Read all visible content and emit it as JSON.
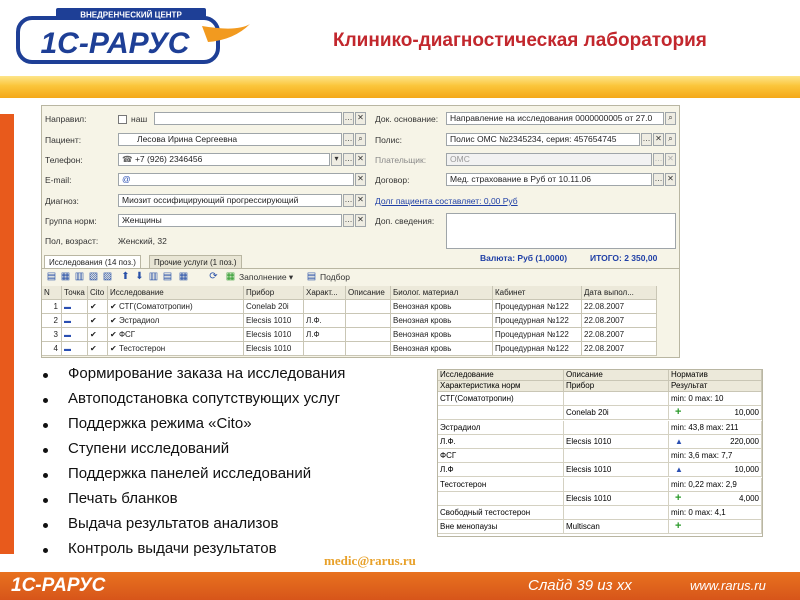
{
  "header": {
    "logo_top": "ВНЕДРЕНЧЕСКИЙ ЦЕНТР",
    "logo_main": "1С-РАРУС",
    "title": "Клинико-диагностическая лаборатория"
  },
  "form": {
    "labels": {
      "direction": "Направил:",
      "patient": "Пациент:",
      "phone": "Телефон:",
      "email": "E-mail:",
      "diagnosis": "Диагноз:",
      "norm_group": "Группа норм:",
      "sex_age": "Пол, возраст:",
      "doc_basis": "Док. основание:",
      "policy": "Полис:",
      "payer": "Плательщик:",
      "contract": "Договор:",
      "extra": "Доп. сведения:"
    },
    "direction_check_label": "наш",
    "patient_value": "Лесова Ирина Сергеевна",
    "phone_value": "+7 (926) 2346456",
    "email_value": "@",
    "diagnosis_value": "Миозит оссифицирующий прогрессирующий",
    "norm_group_value": "Женщины",
    "sex_age_value": "Женский, 32",
    "doc_basis_value": "Направление на исследования 0000000005 от 27.0",
    "policy_value": "Полис ОМС №2345234, серия: 457654745",
    "payer_value": "ОМС",
    "contract_value": "Мед. страхование в Руб от 10.11.06",
    "debt_link": "Долг пациента составляет: 0,00 Руб",
    "currency_text": "Валюта: Руб (1,0000)",
    "total_text": "ИТОГО: 2 350,00"
  },
  "tabs": [
    {
      "label": "Исследования (14 поз.)"
    },
    {
      "label": "Прочие услуги (1 поз.)"
    }
  ],
  "toolbar": {
    "fill_label": "Заполнение",
    "select_label": "Подбор"
  },
  "grid": {
    "headers": [
      "N",
      "Точка",
      "Cito",
      "Исследование",
      "Прибор",
      "Характ...",
      "Описание",
      "Биолог. материал",
      "Кабинет",
      "Дата выпол..."
    ],
    "rows": [
      {
        "n": "1",
        "study": "СТГ(Соматотропин)",
        "device": "Conelab 20i",
        "char": "",
        "material": "Венозная кровь",
        "room": "Процедурная №122",
        "date": "22.08.2007"
      },
      {
        "n": "2",
        "study": "Эстрадиол",
        "device": "Elecsis 1010",
        "char": "Л.Ф.",
        "material": "Венозная кровь",
        "room": "Процедурная №122",
        "date": "22.08.2007"
      },
      {
        "n": "3",
        "study": "ФСГ",
        "device": "Elecsis 1010",
        "char": "Л.Ф",
        "material": "Венозная кровь",
        "room": "Процедурная №122",
        "date": "22.08.2007"
      },
      {
        "n": "4",
        "study": "Тестостерон",
        "device": "Elecsis 1010",
        "char": "",
        "material": "Венозная кровь",
        "room": "Процедурная №122",
        "date": "22.08.2007"
      }
    ]
  },
  "bullets": [
    "Формирование заказа на исследования",
    "Автоподстановка сопутствующих услуг",
    "Поддержка режима «Cito»",
    "Ступени исследований",
    "Поддержка панелей исследований",
    "Печать бланков",
    "Выдача результатов анализов",
    "Контроль выдачи результатов"
  ],
  "results": {
    "headers_row1": [
      "Исследование",
      "Описание",
      "Норматив"
    ],
    "headers_row2": [
      "Характеристика норм",
      "Прибор",
      "Результат"
    ],
    "items": [
      {
        "study": "СТГ(Соматотропин)",
        "char": "",
        "device": "Conelab 20i",
        "norm": "min: 0 max: 10",
        "mark": "plus",
        "value": "10,000"
      },
      {
        "study": "Эстрадиол",
        "char": "Л.Ф.",
        "device": "Elecsis 1010",
        "norm": "min: 43,8 max: 211",
        "mark": "tri",
        "value": "220,000"
      },
      {
        "study": "ФСГ",
        "char": "Л.Ф",
        "device": "Elecsis 1010",
        "norm": "min: 3,6 max: 7,7",
        "mark": "tri",
        "value": "10,000"
      },
      {
        "study": "Тестостерон",
        "char": "",
        "device": "Elecsis 1010",
        "norm": "min: 0,22 max: 2,9",
        "mark": "plus",
        "value": "4,000"
      },
      {
        "study": "Свободный тестостерон",
        "char": "Вне менопаузы",
        "device": "Multiscan",
        "norm": "min: 0 max: 4,1",
        "mark": "plus",
        "value": ""
      }
    ]
  },
  "footer": {
    "email": "medic@rarus.ru",
    "logo": "1С-РАРУС",
    "slide": "Слайд 39 из xx",
    "site": "www.rarus.ru"
  },
  "colors": {
    "title_red": "#c2272d",
    "orange": "#e8721f",
    "logo_blue": "#1e3f96"
  }
}
